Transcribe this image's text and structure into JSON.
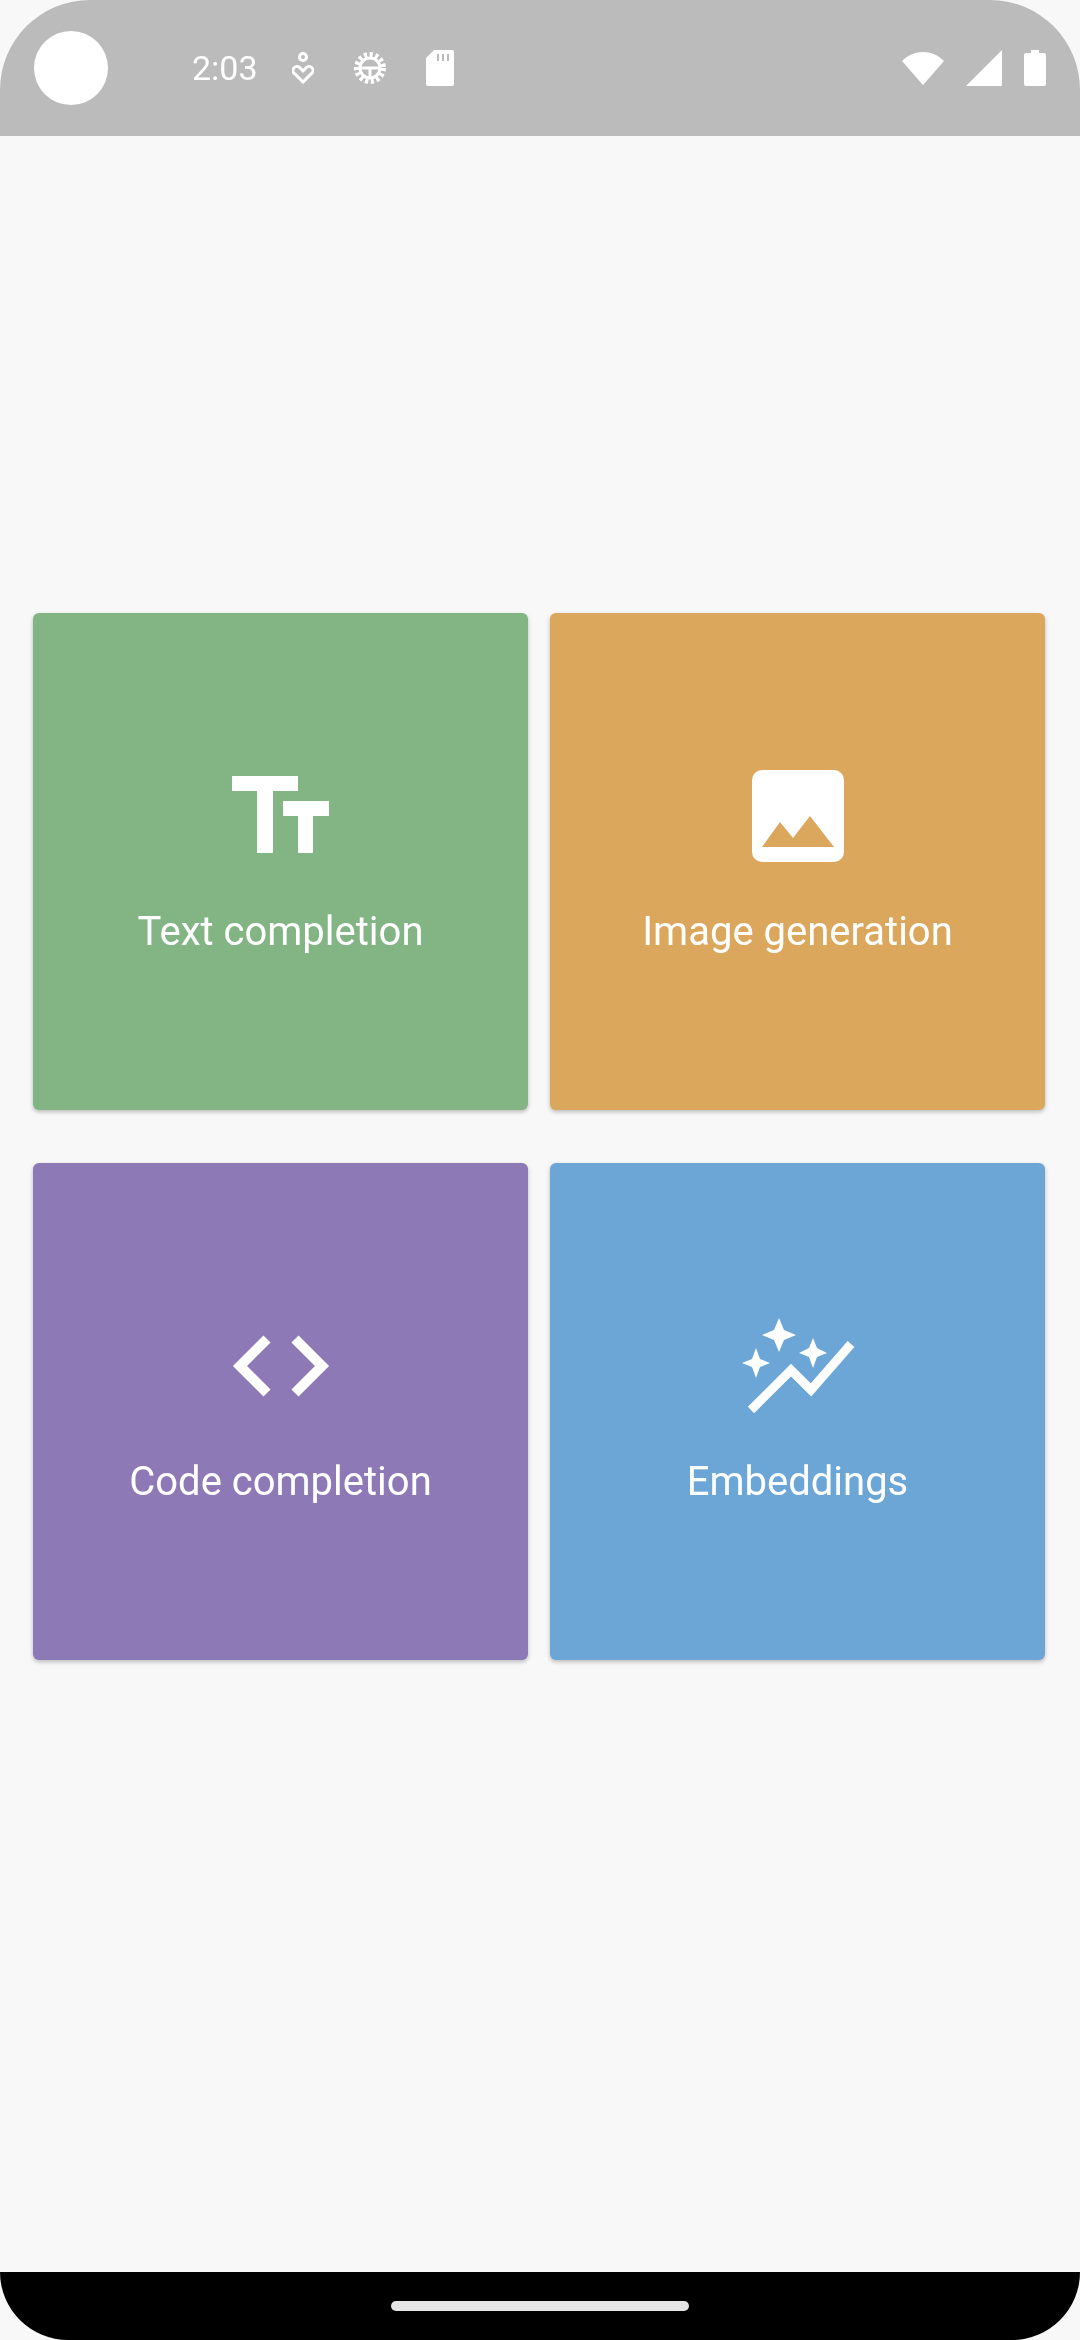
{
  "status_bar": {
    "time": "2:03"
  },
  "cards": [
    {
      "kind": "text",
      "label": "Text completion",
      "color": "#83b484"
    },
    {
      "kind": "image",
      "label": "Image generation",
      "color": "#dba75c"
    },
    {
      "kind": "code",
      "label": "Code completion",
      "color": "#8e79b7"
    },
    {
      "kind": "embeddings",
      "label": "Embeddings",
      "color": "#6ca6d6"
    }
  ]
}
